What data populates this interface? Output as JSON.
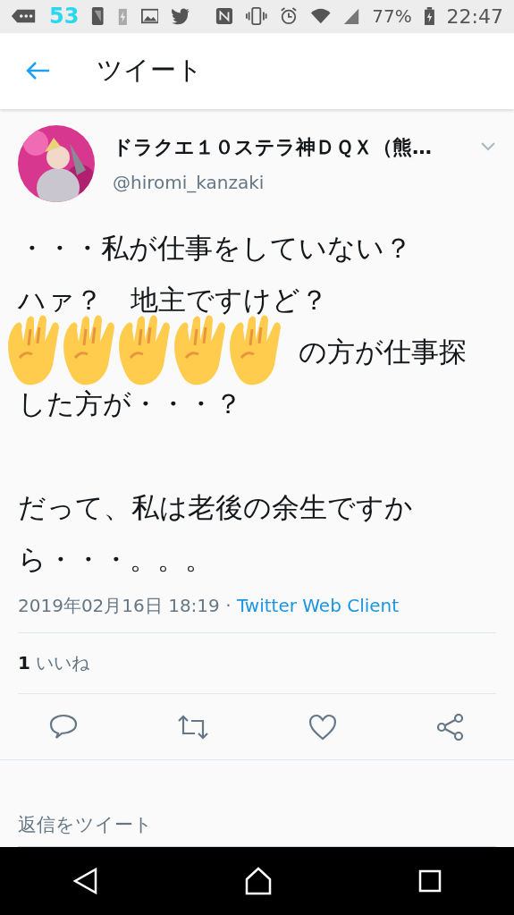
{
  "status_bar": {
    "notification_count": "53",
    "battery": "77%",
    "time": "22:47"
  },
  "header": {
    "title": "ツイート"
  },
  "tweet": {
    "display_name": "ドラクエ１０ステラ神ＤＱＸ（熊…",
    "handle": "@hiromi_kanzaki",
    "lines": [
      {
        "kind": "text",
        "text": "・・・私が仕事をしていない？"
      },
      {
        "kind": "text",
        "text": "ハァ？　地主ですけど？"
      },
      {
        "kind": "covered",
        "text": "の方が仕事探"
      },
      {
        "kind": "text",
        "text": "した方が・・・？"
      },
      {
        "kind": "blank"
      },
      {
        "kind": "text",
        "text": "だって、私は老後の余生ですか"
      },
      {
        "kind": "text",
        "text": "ら・・・。。。"
      }
    ],
    "timestamp": "2019年02月16日 18:19 · ",
    "source": "Twitter Web Client",
    "like_count": "1",
    "like_label": "いいね"
  },
  "reply": {
    "placeholder": "返信をツイート"
  }
}
